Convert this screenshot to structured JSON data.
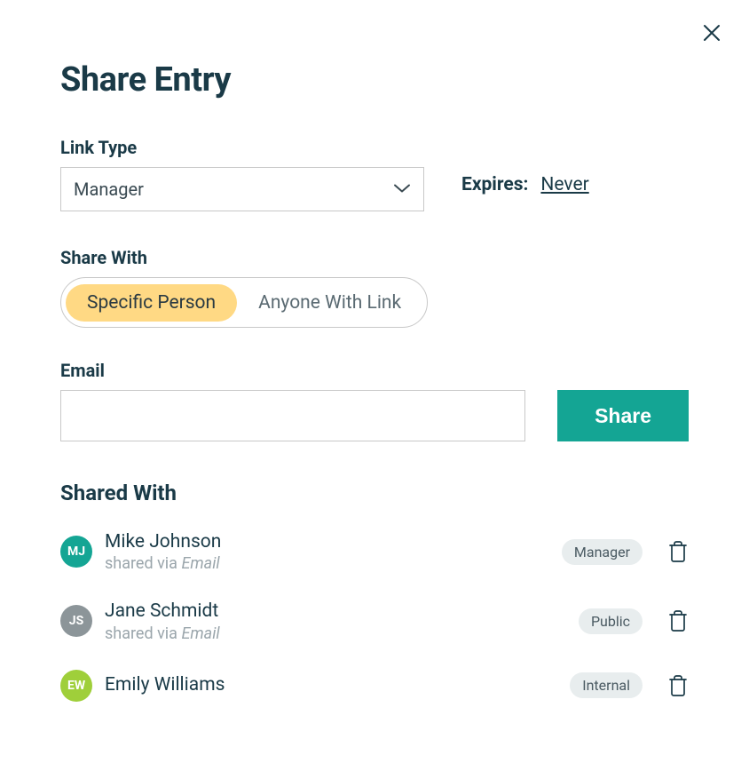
{
  "title": "Share Entry",
  "linkType": {
    "label": "Link Type",
    "value": "Manager"
  },
  "expires": {
    "label": "Expires:",
    "value": "Never"
  },
  "shareWith": {
    "label": "Share With",
    "options": [
      {
        "label": "Specific Person",
        "active": true
      },
      {
        "label": "Anyone With Link",
        "active": false
      }
    ]
  },
  "email": {
    "label": "Email",
    "value": ""
  },
  "shareButton": "Share",
  "sharedWith": {
    "title": "Shared With",
    "entries": [
      {
        "initials": "MJ",
        "avatarColor": "#14a594",
        "name": "Mike Johnson",
        "sharedViaPrefix": "shared via ",
        "sharedViaMethod": "Email",
        "role": "Manager"
      },
      {
        "initials": "JS",
        "avatarColor": "#8c9599",
        "name": "Jane Schmidt",
        "sharedViaPrefix": "shared via ",
        "sharedViaMethod": "Email",
        "role": "Public"
      },
      {
        "initials": "EW",
        "avatarColor": "#9fcf3a",
        "name": "Emily Williams",
        "sharedViaPrefix": "",
        "sharedViaMethod": "",
        "role": "Internal"
      }
    ]
  }
}
